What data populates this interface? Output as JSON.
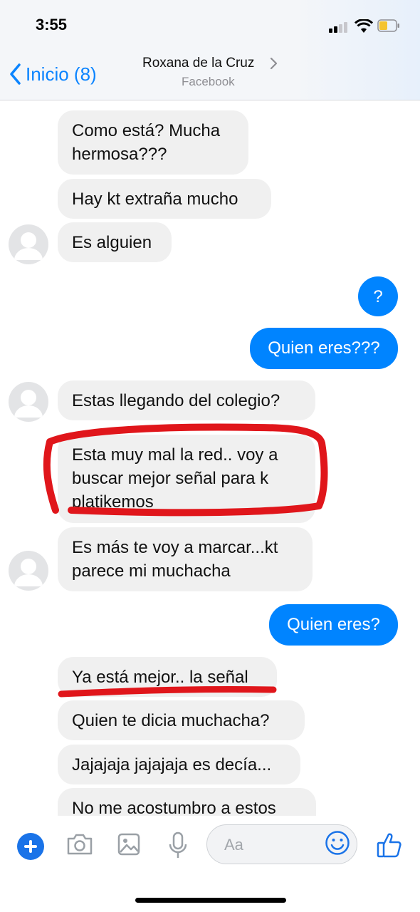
{
  "status_bar": {
    "time": "3:55"
  },
  "nav": {
    "back_label": "Inicio (8)",
    "contact_name": "Roxana de la Cruz",
    "contact_subtitle": "Facebook"
  },
  "messages": [
    {
      "direction": "in",
      "text": "Como está? Mucha\nhermosa???"
    },
    {
      "direction": "in",
      "text": "Hay kt extraña mucho"
    },
    {
      "direction": "in",
      "text": "Es alguien"
    },
    {
      "direction": "out",
      "text": "?"
    },
    {
      "direction": "out",
      "text": "Quien eres???"
    },
    {
      "direction": "in",
      "text": "Estas llegando del colegio?"
    },
    {
      "direction": "in",
      "text": "Esta muy mal la red..  voy a\nbuscar  mejor señal para k\nplatikemos"
    },
    {
      "direction": "in",
      "text": "Es más te voy a marcar...kt\nparece mi muchacha"
    },
    {
      "direction": "out",
      "text": "Quien eres?"
    },
    {
      "direction": "in",
      "text": "Ya está mejor.. la señal"
    },
    {
      "direction": "in",
      "text": "Quien te dicia muchacha?"
    },
    {
      "direction": "in",
      "text": "Jajajaja jajajaja es decía..."
    },
    {
      "direction": "in",
      "text": "No me acostumbro a estos"
    }
  ],
  "composer": {
    "placeholder": "Aa",
    "icons": [
      "plus-icon",
      "camera-icon",
      "image-icon",
      "microphone-icon",
      "emoji-icon",
      "thumbs-up-icon"
    ]
  },
  "colors": {
    "accent": "#0084ff",
    "incoming_bubble": "#f0f0f0",
    "annotation_red": "#e0161b"
  }
}
